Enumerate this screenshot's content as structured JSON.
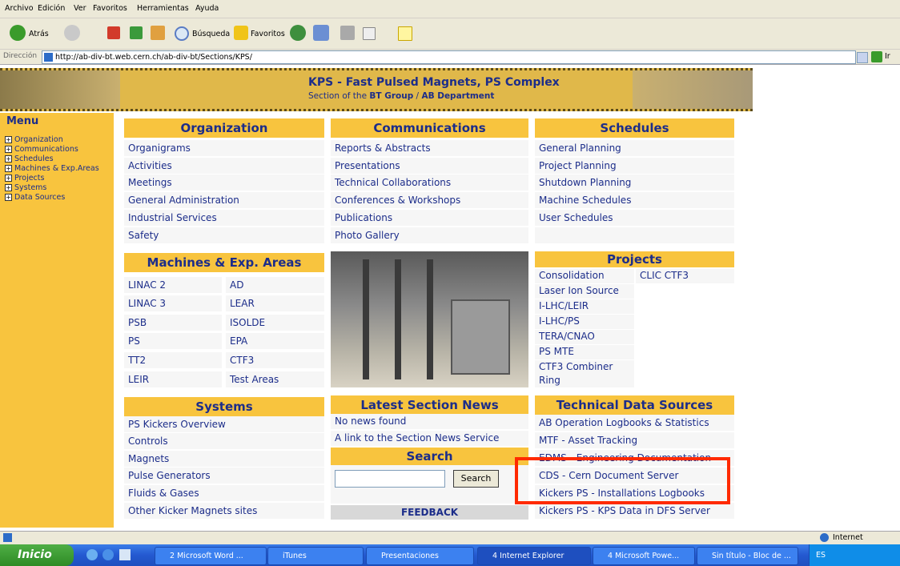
{
  "menubar": {
    "items": [
      "Archivo",
      "Edición",
      "Ver",
      "Favoritos",
      "Herramientas",
      "Ayuda"
    ]
  },
  "toolbar": {
    "back_label": "Atrás",
    "search_label": "Búsqueda",
    "favorites_label": "Favoritos"
  },
  "address": {
    "label": "Dirección",
    "url": "http://ab-div-bt.web.cern.ch/ab-div-bt/Sections/KPS/",
    "go_label": "Ir"
  },
  "banner": {
    "title": "KPS - Fast Pulsed Magnets, PS Complex",
    "subtitle_prefix": "Section of the ",
    "group": "BT Group",
    "sep": " / ",
    "department": "AB Department"
  },
  "sidebar": {
    "title": "Menu",
    "items": [
      "Organization",
      "Communications",
      "Schedules",
      "Machines & Exp.Areas",
      "Projects",
      "Systems",
      "Data Sources"
    ]
  },
  "organization": {
    "title": "Organization",
    "links": [
      "Organigrams",
      "Activities",
      "Meetings",
      "General Administration",
      "Industrial Services",
      "Safety"
    ]
  },
  "communications": {
    "title": "Communications",
    "links": [
      "Reports & Abstracts",
      "Presentations",
      "Technical Collaborations",
      "Conferences & Workshops",
      "Publications",
      "Photo Gallery"
    ]
  },
  "schedules": {
    "title": "Schedules",
    "links": [
      "General Planning",
      "Project Planning",
      "Shutdown Planning",
      "Machine Schedules",
      "User Schedules"
    ]
  },
  "machines": {
    "title": "Machines & Exp. Areas",
    "left": [
      "LINAC 2",
      "LINAC 3",
      "PSB",
      "PS",
      "TT2",
      "LEIR"
    ],
    "right": [
      "AD",
      "LEAR",
      "ISOLDE",
      "EPA",
      "CTF3",
      "Test Areas"
    ]
  },
  "projects": {
    "title": "Projects",
    "left": [
      "Consolidation",
      "Laser Ion Source",
      "I-LHC/LEIR",
      "I-LHC/PS",
      "TERA/CNAO",
      "PS MTE",
      "CTF3 Combiner Ring"
    ],
    "right": [
      "CLIC CTF3"
    ]
  },
  "systems": {
    "title": "Systems",
    "links": [
      "PS Kickers Overview",
      "Controls",
      "Magnets",
      "Pulse Generators",
      "Fluids & Gases",
      "Other Kicker Magnets sites"
    ]
  },
  "news": {
    "title": "Latest Section News",
    "items": [
      "No news found",
      "A link to the Section News Service"
    ]
  },
  "search": {
    "title": "Search",
    "button_label": "Search",
    "value": ""
  },
  "feedback": {
    "label": "FEEDBACK"
  },
  "technical": {
    "title": "Technical Data Sources",
    "links": [
      "AB Operation Logbooks & Statistics",
      "MTF - Asset Tracking",
      "EDMS - Engineering Documentation",
      "CDS - Cern Document Server",
      "Kickers PS - Installations Logbooks",
      "Kickers PS - KPS Data in DFS Server"
    ]
  },
  "statusbar": {
    "zone": "Internet"
  },
  "taskbar": {
    "start_label": "Inicio",
    "items": [
      "2 Microsoft Word ...",
      "iTunes",
      "Presentaciones",
      "4 Internet Explorer",
      "4 Microsoft Powe...",
      "Sin título - Bloc de ..."
    ],
    "tray_lang": "ES"
  },
  "colors": {
    "accent_yellow": "#f8c43e",
    "link_blue": "#1c2d8a",
    "highlight_red": "#ff2a00"
  }
}
